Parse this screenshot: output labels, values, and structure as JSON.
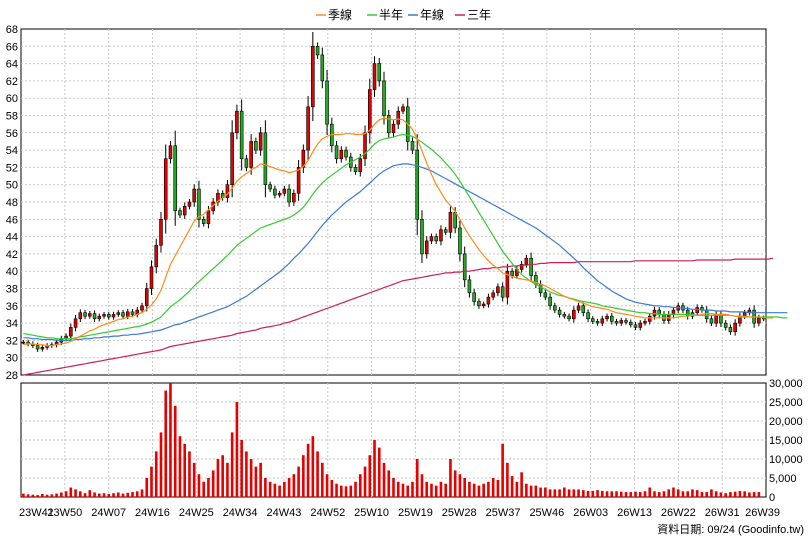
{
  "chart_data": {
    "type": "candlestick-with-volume",
    "legend": [
      {
        "label": "季線",
        "color": "#ff8c1a"
      },
      {
        "label": "半年",
        "color": "#33cc33"
      },
      {
        "label": "年線",
        "color": "#3a7bd5"
      },
      {
        "label": "三年",
        "color": "#cc2255"
      }
    ],
    "x_ticks": [
      "23W41",
      "23W50",
      "24W07",
      "24W16",
      "24W25",
      "24W34",
      "24W43",
      "24W52",
      "25W10",
      "25W19",
      "25W28",
      "25W37",
      "25W46",
      "26W03",
      "26W13",
      "26W22",
      "26W31",
      "26W39"
    ],
    "price_axis": {
      "min": 28,
      "max": 68,
      "ticks": [
        28,
        30,
        32,
        34,
        36,
        38,
        40,
        42,
        44,
        46,
        48,
        50,
        52,
        54,
        56,
        58,
        60,
        62,
        64,
        66,
        68
      ]
    },
    "volume_axis": {
      "min": 0,
      "max": 30000,
      "ticks": [
        "0",
        "5,000",
        "10,000",
        "15,000",
        "20,000",
        "25,000",
        "30,000"
      ]
    },
    "footer": "資料日期: 09/24  (Goodinfo.tw)",
    "close": [
      31.8,
      31.6,
      31.4,
      31,
      31.2,
      31.4,
      31.5,
      31.8,
      32.2,
      32.5,
      33.5,
      34.5,
      35.2,
      34.8,
      35.1,
      34.5,
      34.8,
      35,
      34.7,
      35,
      35.2,
      34.8,
      35.3,
      35,
      35.5,
      36,
      38,
      40.5,
      43,
      46,
      53,
      54.5,
      47,
      46.5,
      47.5,
      48,
      49.5,
      46,
      45.5,
      47,
      48,
      49,
      48.5,
      50,
      56,
      58.5,
      53,
      52,
      55,
      54,
      56,
      50,
      49.5,
      48.8,
      49,
      49.5,
      48,
      49,
      52,
      54,
      59,
      66,
      65,
      62,
      57,
      54.5,
      53,
      54,
      53.2,
      52,
      51.5,
      53,
      56,
      61,
      64,
      62,
      58,
      56,
      57,
      58.5,
      59,
      55,
      54,
      46,
      42,
      43.5,
      44,
      43.5,
      44.8,
      44.5,
      46.8,
      45,
      42,
      39,
      37.5,
      36.5,
      36,
      36.2,
      37,
      37.5,
      38.2,
      37,
      40,
      39.5,
      40.2,
      40.8,
      41.5,
      39.5,
      38.5,
      37.5,
      37,
      36,
      35.5,
      35,
      34.8,
      34.5,
      35.5,
      36,
      35.2,
      34.5,
      34.2,
      34,
      34.5,
      34.8,
      34.2,
      34,
      34.3,
      34.1,
      33.8,
      33.5,
      34,
      34.2,
      34.8,
      35.5,
      35,
      34.3,
      35,
      35.5,
      36,
      35.5,
      34.8,
      35.2,
      35.8,
      35.5,
      34.5,
      34,
      35,
      34,
      33.5,
      33,
      34,
      34.8,
      35.2,
      35.5,
      34,
      34.6,
      34.5
    ],
    "ma_quarter": [
      31.5,
      31.6,
      31.6,
      31.5,
      31.5,
      31.4,
      31.4,
      31.5,
      31.6,
      31.7,
      31.9,
      32.2,
      32.5,
      32.8,
      33.1,
      33.3,
      33.6,
      33.8,
      34,
      34.2,
      34.4,
      34.5,
      34.7,
      34.8,
      35,
      35.2,
      35.6,
      36.1,
      36.8,
      37.8,
      39.3,
      40.8,
      41.8,
      42.8,
      43.8,
      44.8,
      45.8,
      46.3,
      46.6,
      47.1,
      47.6,
      48.1,
      48.5,
      48.9,
      49.6,
      50.4,
      50.9,
      51.3,
      51.7,
      52,
      52.4,
      52.3,
      52.1,
      51.9,
      51.7,
      51.6,
      51.4,
      51.5,
      51.7,
      52.1,
      52.8,
      53.8,
      54.7,
      55.3,
      55.6,
      55.8,
      55.8,
      55.8,
      55.9,
      55.9,
      55.8,
      55.8,
      55.9,
      56.3,
      57,
      57.5,
      57.7,
      57.6,
      57.5,
      57.6,
      57.5,
      57,
      56.4,
      55.3,
      53.9,
      52.5,
      51.2,
      50,
      49.1,
      48.2,
      47.6,
      46.9,
      46,
      45,
      44.1,
      43.3,
      42.5,
      41.8,
      41.2,
      40.7,
      40.3,
      39.8,
      39.6,
      39.4,
      39.2,
      39.1,
      39,
      38.9,
      38.7,
      38.5,
      38.3,
      38,
      37.7,
      37.4,
      37.1,
      36.9,
      36.7,
      36.5,
      36.3,
      36.1,
      35.9,
      35.8,
      35.7,
      35.6,
      35.4,
      35.2,
      35.1,
      35,
      34.9,
      34.8,
      34.7,
      34.6,
      34.6,
      34.6,
      34.6,
      34.6,
      34.6,
      34.6,
      34.7,
      34.8,
      34.8,
      34.9,
      34.9,
      35,
      35.1,
      35.1,
      35,
      35,
      35,
      34.9,
      34.8,
      34.7,
      34.7,
      34.7,
      34.7,
      34.7,
      34.6,
      34.6,
      34.6
    ],
    "ma_half": [
      32.8,
      32.7,
      32.6,
      32.5,
      32.4,
      32.3,
      32.3,
      32.2,
      32.2,
      32.2,
      32.2,
      32.3,
      32.4,
      32.5,
      32.6,
      32.7,
      32.8,
      32.9,
      33,
      33.1,
      33.2,
      33.3,
      33.4,
      33.5,
      33.6,
      33.7,
      33.9,
      34.1,
      34.4,
      34.7,
      35.3,
      35.9,
      36.3,
      36.7,
      37.2,
      37.7,
      38.3,
      38.8,
      39.3,
      39.8,
      40.3,
      40.8,
      41.3,
      41.8,
      42.4,
      43,
      43.4,
      43.8,
      44.2,
      44.6,
      45,
      45.2,
      45.4,
      45.6,
      45.8,
      46,
      46.2,
      46.5,
      46.9,
      47.4,
      48.1,
      48.9,
      49.6,
      50.2,
      50.7,
      51.1,
      51.5,
      51.9,
      52.3,
      52.6,
      52.9,
      53.2,
      53.6,
      54.1,
      54.7,
      55.1,
      55.3,
      55.4,
      55.5,
      55.7,
      55.8,
      55.7,
      55.6,
      55.3,
      54.9,
      54.5,
      54.1,
      53.6,
      53.1,
      52.5,
      51.9,
      51.2,
      50.4,
      49.5,
      48.6,
      47.7,
      46.8,
      45.9,
      45,
      44.1,
      43.2,
      42.3,
      41.6,
      40.9,
      40.2,
      39.6,
      39.2,
      38.8,
      38.5,
      38.2,
      37.9,
      37.6,
      37.4,
      37.2,
      37.1,
      36.9,
      36.8,
      36.6,
      36.5,
      36.4,
      36.3,
      36.2,
      36,
      35.9,
      35.8,
      35.7,
      35.6,
      35.5,
      35.4,
      35.3,
      35.2,
      35.2,
      35.1,
      35.1,
      35,
      35,
      35,
      35,
      35,
      35,
      35,
      35,
      34.9,
      34.9,
      34.9,
      34.9,
      34.9,
      34.9,
      34.9,
      34.9,
      34.8,
      34.8,
      34.8,
      34.7,
      34.7,
      34.7,
      34.7,
      34.7,
      34.7,
      34.7,
      34.6,
      34.6
    ],
    "ma_year": [
      32.3,
      32.3,
      32.2,
      32.2,
      32.1,
      32.1,
      32.1,
      32,
      32,
      32,
      32,
      32.1,
      32.1,
      32.2,
      32.2,
      32.3,
      32.3,
      32.4,
      32.4,
      32.5,
      32.5,
      32.6,
      32.6,
      32.7,
      32.7,
      32.8,
      32.9,
      33,
      33.1,
      33.2,
      33.4,
      33.6,
      33.8,
      33.9,
      34.1,
      34.3,
      34.5,
      34.7,
      34.9,
      35.1,
      35.3,
      35.5,
      35.7,
      35.9,
      36.2,
      36.5,
      36.8,
      37.1,
      37.5,
      37.9,
      38.3,
      38.7,
      39.1,
      39.5,
      39.9,
      40.4,
      40.9,
      41.5,
      42,
      42.6,
      43.2,
      43.9,
      44.6,
      45.3,
      45.9,
      46.5,
      47,
      47.5,
      48,
      48.4,
      48.8,
      49.2,
      49.7,
      50.2,
      50.7,
      51.2,
      51.6,
      51.9,
      52.2,
      52.3,
      52.4,
      52.4,
      52.3,
      52.2,
      52,
      51.8,
      51.6,
      51.3,
      51,
      50.7,
      50.4,
      50.1,
      49.8,
      49.5,
      49.2,
      48.9,
      48.6,
      48.3,
      48,
      47.7,
      47.4,
      47.1,
      46.8,
      46.5,
      46.2,
      45.9,
      45.6,
      45.3,
      45,
      44.6,
      44.2,
      43.8,
      43.4,
      43,
      42.5,
      42,
      41.5,
      41,
      40.4,
      39.9,
      39.4,
      38.9,
      38.5,
      38.1,
      37.7,
      37.4,
      37.1,
      36.8,
      36.6,
      36.4,
      36.3,
      36.2,
      36.1,
      36,
      36,
      35.9,
      35.9,
      35.8,
      35.8,
      35.7,
      35.7,
      35.6,
      35.6,
      35.5,
      35.5,
      35.5,
      35.4,
      35.4,
      35.4,
      35.3,
      35.3,
      35.3,
      35.3,
      35.2,
      35.2,
      35.2,
      35.2,
      35.2,
      35.2,
      35.2,
      35.2,
      35.2
    ],
    "ma_3year": [
      28,
      28.1,
      28.2,
      28.3,
      28.4,
      28.5,
      28.6,
      28.7,
      28.8,
      28.9,
      29,
      29.1,
      29.2,
      29.3,
      29.4,
      29.5,
      29.6,
      29.7,
      29.8,
      29.9,
      30,
      30.1,
      30.2,
      30.3,
      30.4,
      30.5,
      30.6,
      30.7,
      30.8,
      30.9,
      31.1,
      31.3,
      31.4,
      31.5,
      31.6,
      31.7,
      31.8,
      31.9,
      32,
      32.1,
      32.2,
      32.3,
      32.4,
      32.5,
      32.6,
      32.8,
      32.9,
      33,
      33.1,
      33.2,
      33.4,
      33.5,
      33.6,
      33.7,
      33.8,
      34,
      34.1,
      34.3,
      34.5,
      34.7,
      34.9,
      35.1,
      35.3,
      35.5,
      35.7,
      35.9,
      36.1,
      36.3,
      36.5,
      36.7,
      36.9,
      37.1,
      37.3,
      37.5,
      37.7,
      37.9,
      38.1,
      38.3,
      38.5,
      38.7,
      38.9,
      39,
      39.1,
      39.2,
      39.3,
      39.4,
      39.5,
      39.6,
      39.7,
      39.8,
      39.8,
      39.9,
      39.9,
      40,
      40,
      40.1,
      40.2,
      40.3,
      40.3,
      40.4,
      40.4,
      40.5,
      40.5,
      40.6,
      40.6,
      40.7,
      40.7,
      40.8,
      40.8,
      40.9,
      40.9,
      41,
      41,
      41,
      41,
      41,
      41,
      41.1,
      41.1,
      41.1,
      41.1,
      41.1,
      41.1,
      41.1,
      41.1,
      41.1,
      41.1,
      41.1,
      41.1,
      41.2,
      41.2,
      41.2,
      41.2,
      41.2,
      41.2,
      41.2,
      41.2,
      41.2,
      41.2,
      41.2,
      41.2,
      41.2,
      41.3,
      41.3,
      41.3,
      41.3,
      41.3,
      41.3,
      41.3,
      41.3,
      41.4,
      41.4,
      41.4,
      41.4,
      41.4,
      41.4,
      41.4,
      41.4,
      41.5
    ],
    "volume": [
      900,
      700,
      600,
      500,
      800,
      600,
      700,
      900,
      1200,
      1500,
      2500,
      2000,
      1500,
      1000,
      1800,
      1200,
      900,
      1000,
      800,
      1000,
      1200,
      900,
      1100,
      1300,
      1500,
      2000,
      5000,
      8000,
      12000,
      17000,
      28000,
      31000,
      24000,
      16000,
      14000,
      12000,
      9000,
      6000,
      4000,
      5000,
      7000,
      10000,
      11000,
      9000,
      17000,
      25000,
      15000,
      12000,
      10000,
      8000,
      9000,
      5000,
      4000,
      3500,
      3000,
      4000,
      5000,
      6000,
      8000,
      11000,
      14000,
      16000,
      12000,
      9000,
      6000,
      4500,
      3500,
      3000,
      2800,
      3000,
      4000,
      6000,
      8000,
      11000,
      15000,
      13000,
      9000,
      7000,
      5000,
      4000,
      3500,
      3000,
      4000,
      10000,
      6000,
      4000,
      3500,
      3000,
      4000,
      3500,
      10000,
      7000,
      6000,
      5000,
      4000,
      3500,
      3000,
      3500,
      4000,
      5000,
      4500,
      14000,
      9000,
      5500,
      4000,
      6500,
      3500,
      3000,
      3000,
      2500,
      2500,
      2000,
      2000,
      2000,
      2500,
      2000,
      2000,
      2000,
      1800,
      1600,
      1600,
      1800,
      1600,
      1500,
      1500,
      1500,
      1400,
      1300,
      1300,
      1400,
      1300,
      1500,
      2500,
      1500,
      1300,
      1500,
      2000,
      2500,
      2000,
      1500,
      1500,
      2000,
      1800,
      1300,
      1300,
      2000,
      1500,
      1200,
      1000,
      1300,
      1400,
      1600,
      1500,
      1200,
      1300,
      1300
    ]
  }
}
